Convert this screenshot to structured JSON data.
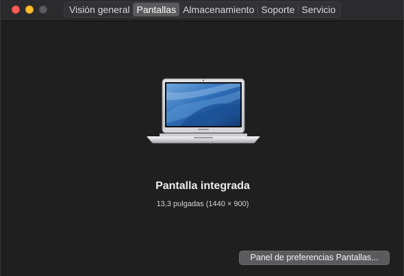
{
  "tabs": [
    {
      "label": "Visión general",
      "active": false
    },
    {
      "label": "Pantallas",
      "active": true
    },
    {
      "label": "Almacenamiento",
      "active": false
    },
    {
      "label": "Soporte",
      "active": false
    },
    {
      "label": "Servicio",
      "active": false
    }
  ],
  "display": {
    "icon": "macbook-air-icon",
    "name": "Pantalla integrada",
    "size": "13,3 pulgadas (1440 × 900)"
  },
  "preferences_button": {
    "label": "Panel de preferencias Pantallas..."
  },
  "colors": {
    "background": "#1f1f20",
    "close": "#ff5f57",
    "minimize": "#febc2e",
    "zoom_disabled": "#5c5c5e",
    "active_tab": "#5a5a5d"
  }
}
